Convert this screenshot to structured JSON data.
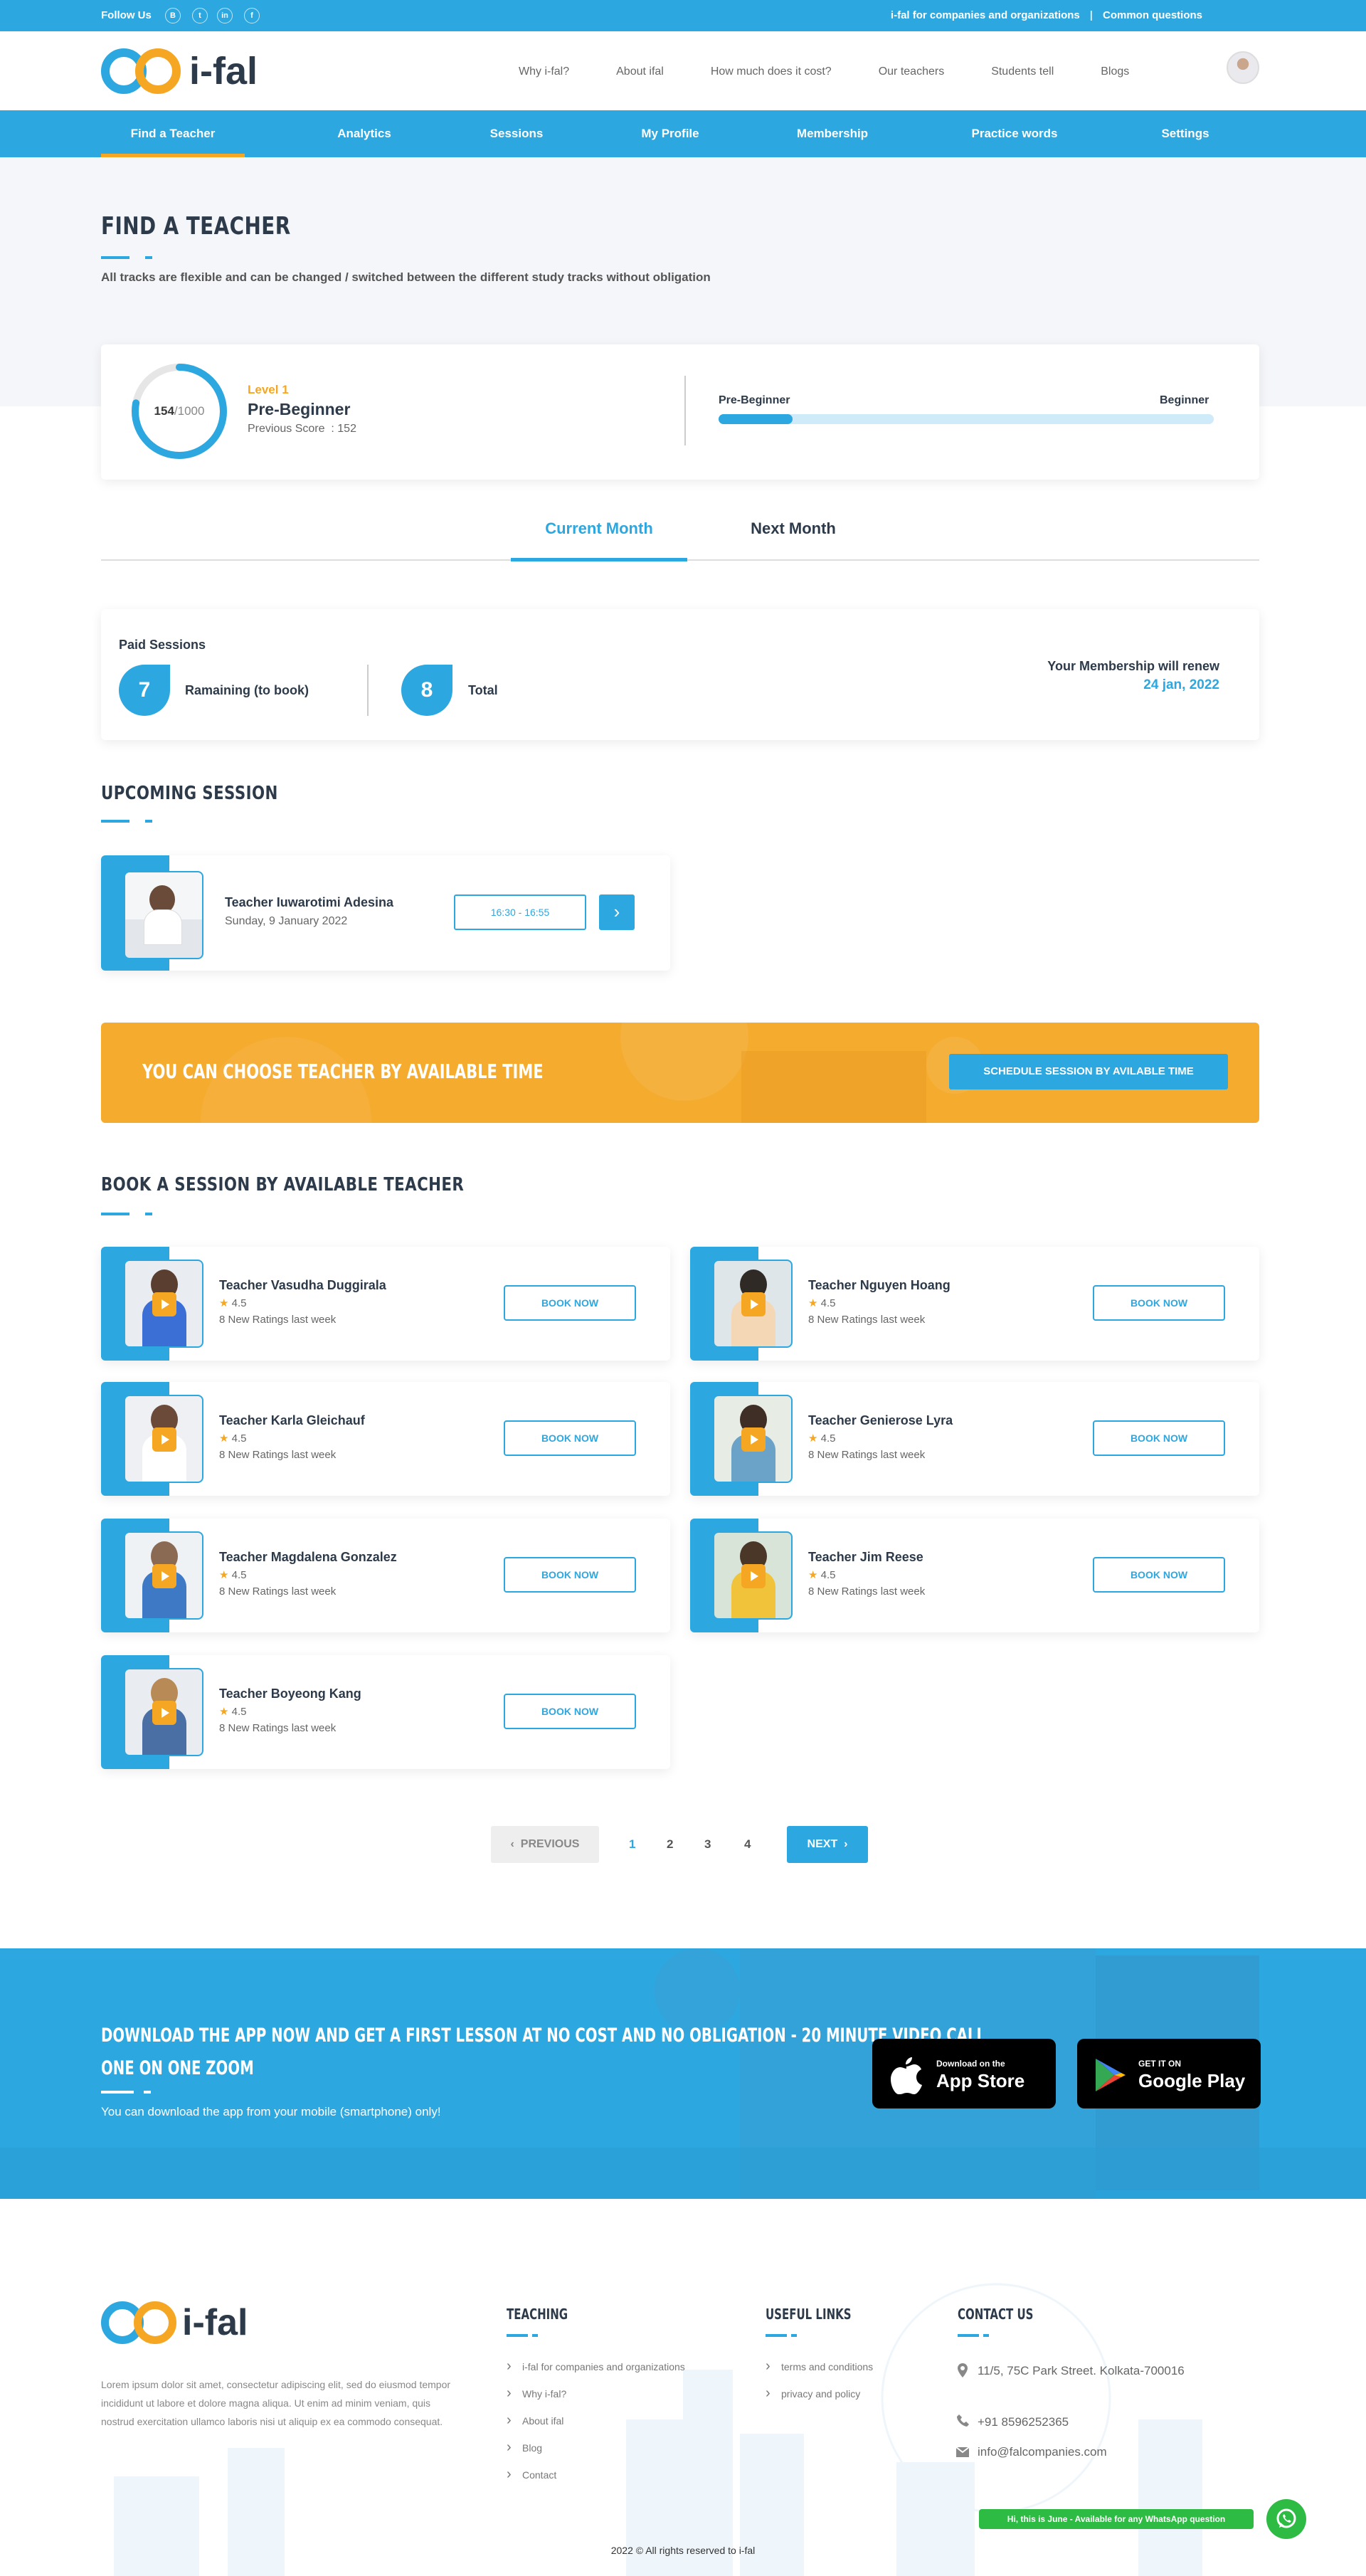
{
  "topbar": {
    "follow": "Follow Us",
    "social": [
      "blogger-icon",
      "twitter-icon",
      "linkedin-icon",
      "facebook-icon"
    ],
    "social_glyphs": [
      "B",
      "t",
      "in",
      "f"
    ],
    "link1": "i-fal for companies and organizations",
    "sep": "|",
    "link2": "Common questions"
  },
  "brand": {
    "name": "i-fal"
  },
  "nav": [
    "Why i-fal?",
    "About ifal",
    "How much does it cost?",
    "Our teachers",
    "Students tell",
    "Blogs"
  ],
  "menu": [
    "Find a Teacher",
    "Analytics",
    "Sessions",
    "My Profile",
    "Membership",
    "Practice words",
    "Settings"
  ],
  "hero": {
    "title": "FIND A TEACHER",
    "subtitle": "All tracks are flexible and can be changed / switched between the different study tracks without obligation"
  },
  "level": {
    "score": "154",
    "max": "/1000",
    "score_fraction": 0.154,
    "level_label": "Level 1",
    "level_name": "Pre-Beginner",
    "prev_label": "Previous Score",
    "prev_value": ": 152",
    "from": "Pre-Beginner",
    "to": "Beginner",
    "progress": 0.15
  },
  "tabs": {
    "current": "Current Month",
    "next": "Next Month"
  },
  "sessions": {
    "paid_label": "Paid Sessions",
    "remaining_num": "7",
    "remaining_label": "Ramaining (to book)",
    "total_num": "8",
    "total_label": "Total",
    "renew_label": "Your Membership will renew",
    "renew_date": "24 jan, 2022"
  },
  "upcoming": {
    "title": "UPCOMING SESSION",
    "teacher": "Teacher Iuwarotimi Adesina",
    "date": "Sunday, 9 January 2022",
    "time": "16:30 - 16:55"
  },
  "banner": {
    "text": "YOU CAN CHOOSE TEACHER BY AVAILABLE TIME",
    "button": "SCHEDULE SESSION BY AVILABLE TIME"
  },
  "book": {
    "title": "BOOK A SESSION BY AVAILABLE TEACHER",
    "button": "BOOK NOW",
    "teachers": [
      {
        "name": "Teacher Vasudha Duggirala",
        "rating": "4.5",
        "note": "8 New Ratings last week"
      },
      {
        "name": "Teacher Nguyen Hoang",
        "rating": "4.5",
        "note": "8 New Ratings last week"
      },
      {
        "name": "Teacher Karla Gleichauf",
        "rating": "4.5",
        "note": "8 New Ratings last week"
      },
      {
        "name": "Teacher Genierose Lyra",
        "rating": "4.5",
        "note": "8 New Ratings last week"
      },
      {
        "name": "Teacher Magdalena Gonzalez",
        "rating": "4.5",
        "note": "8 New Ratings last week"
      },
      {
        "name": "Teacher Jim Reese",
        "rating": "4.5",
        "note": "8 New Ratings last week"
      },
      {
        "name": "Teacher Boyeong Kang",
        "rating": "4.5",
        "note": "8 New Ratings last week"
      }
    ]
  },
  "pagination": {
    "prev": "PREVIOUS",
    "pages": [
      "1",
      "2",
      "3",
      "4"
    ],
    "next": "NEXT"
  },
  "app": {
    "title_line1": "DOWNLOAD THE APP NOW AND GET A FIRST LESSON AT NO COST AND NO OBLIGATION - 20 MINUTE VIDEO CALL",
    "title_line2": "ONE ON ONE ZOOM",
    "note": "You can download the app from your mobile (smartphone) only!",
    "apple_small": "Download on the",
    "apple_big": "App Store",
    "google_small": "GET IT ON",
    "google_big": "Google Play"
  },
  "footer": {
    "about": "Lorem ipsum dolor sit amet, consectetur adipiscing elit, sed do eiusmod tempor incididunt ut labore et dolore magna aliqua. Ut enim ad minim veniam, quis nostrud exercitation ullamco laboris nisi ut aliquip ex ea commodo consequat.",
    "teaching_title": "TEACHING",
    "teaching": [
      "i-fal for companies and organizations",
      "Why i-fal?",
      "About ifal",
      "Blog",
      "Contact"
    ],
    "useful_title": "USEFUL LINKS",
    "useful": [
      "terms and conditions",
      "privacy and policy"
    ],
    "contact_title": "CONTACT US",
    "address": "11/5, 75C Park Street. Kolkata-700016",
    "phone": "+91 8596252365",
    "email": "info@falcompanies.com",
    "copyright": "2022 © All rights reserved to i-fal",
    "whatsapp": "Hi, this is June - Available for any WhatsApp question"
  },
  "colors": {
    "primary": "#2ca7e0",
    "accent": "#f5a623",
    "dark": "#2d3a4a"
  }
}
